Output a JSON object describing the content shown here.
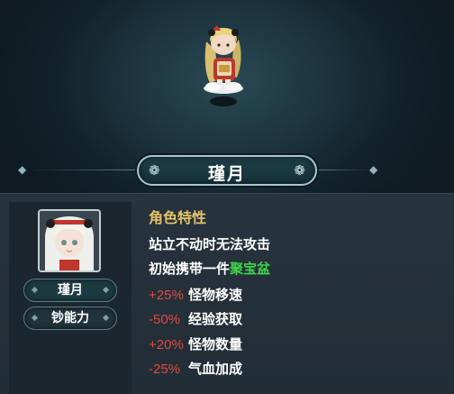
{
  "character": {
    "name": "瑾月",
    "ability_label": "钞能力"
  },
  "traits": {
    "heading": "角色特性",
    "lines": [
      {
        "text": "站立不动时无法攻击"
      },
      {
        "prefix": "初始携带一件",
        "highlight": "聚宝盆"
      }
    ],
    "stats": [
      {
        "value": "+25%",
        "label": "怪物移速"
      },
      {
        "value": "-50%",
        "label": "经验获取"
      },
      {
        "value": "+20%",
        "label": "怪物数量"
      },
      {
        "value": "-25%",
        "label": "气血加成"
      }
    ]
  },
  "colors": {
    "heading": "#e6c36a",
    "highlight": "#3fd34a",
    "stat_value": "#e04a3f",
    "plate_border": "#a8c7cc"
  },
  "icons": {
    "plate_ornament": "flower-ornament-icon"
  }
}
